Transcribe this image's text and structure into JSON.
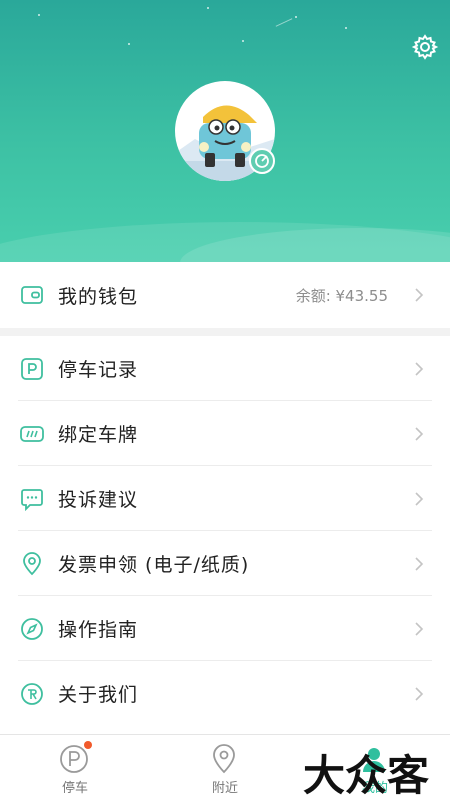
{
  "colors": {
    "accent": "#2fbf9e",
    "header_top": "#2aa89a",
    "header_bottom": "#49cfae",
    "badge_dot": "#f15a2b"
  },
  "header": {
    "settings_icon": "gear-icon",
    "avatar": "car-mascot-avatar",
    "edit_icon": "edit-icon"
  },
  "wallet": {
    "label": "我的钱包",
    "balance": "余额: ¥43.55",
    "icon": "wallet-icon"
  },
  "menu": {
    "items": [
      {
        "label": "停车记录",
        "icon": "parking-icon"
      },
      {
        "label": "绑定车牌",
        "icon": "license-plate-icon"
      },
      {
        "label": "投诉建议",
        "icon": "chat-icon"
      },
      {
        "label": "发票申领 (电子/纸质)",
        "icon": "location-pin-icon"
      },
      {
        "label": "操作指南",
        "icon": "compass-icon"
      },
      {
        "label": "关于我们",
        "icon": "about-icon"
      }
    ]
  },
  "tabbar": {
    "tabs": [
      {
        "label": "停车",
        "icon": "parking-tab-icon",
        "badge": true
      },
      {
        "label": "附近",
        "icon": "location-tab-icon"
      },
      {
        "label": "我的",
        "icon": "profile-tab-icon",
        "active": true
      }
    ]
  },
  "watermark": {
    "text": "大众客"
  }
}
